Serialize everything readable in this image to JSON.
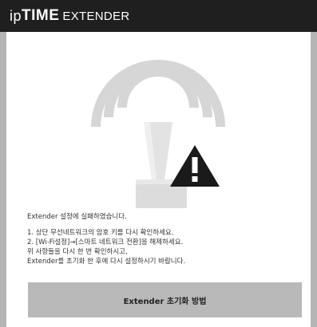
{
  "header": {
    "brand_ip": "ip",
    "brand_time": "TIME",
    "brand_sub": "EXTENDER"
  },
  "message": {
    "title": "Extender 설정에 실패하였습니다.",
    "lines": [
      "1. 상단 무선네트워크의 암호 키를 다시 확인하세요.",
      "2. [Wi-Fi설정]→[스마트 네트워크 전환]을 해제하세요.",
      "위 사항들을 다시 한 번 확인하시고,",
      "Extender를 초기화 한 후에 다시 설정하시기 바랍니다."
    ]
  },
  "button": {
    "label": "Extender 초기화 방법"
  },
  "colors": {
    "header_bg": "#1f1f1f",
    "frame_bg": "#b5b5b5",
    "panel_bg": "#ffffff",
    "button_bg": "#b9b9b9",
    "icon_gray": "#d4d4d4",
    "warning": "#1a1a1a"
  },
  "icons": [
    "wifi-waves-icon",
    "extender-device-icon",
    "warning-icon"
  ]
}
